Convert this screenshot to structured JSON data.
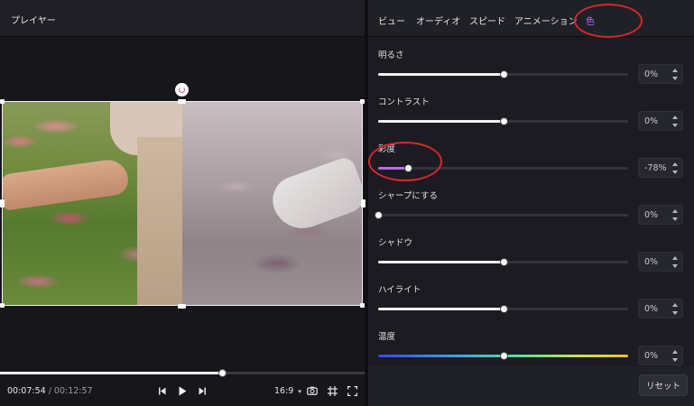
{
  "player": {
    "title": "プレイヤー",
    "current_time": "00:07:54",
    "separator": " / ",
    "duration": "00:12:57",
    "progress": 0.61,
    "aspect_ratio": "16:9"
  },
  "adjust": {
    "tabs": [
      {
        "label": "ビュー",
        "active": false
      },
      {
        "label": "オーディオ",
        "active": false
      },
      {
        "label": "スピード",
        "active": false
      },
      {
        "label": "アニメーション",
        "active": false
      },
      {
        "label": "色",
        "active": true
      }
    ],
    "rows": [
      {
        "label": "明るさ",
        "value": "0%",
        "position": 0.5
      },
      {
        "label": "コントラスト",
        "value": "0%",
        "position": 0.5
      },
      {
        "label": "彩度",
        "value": "-78%",
        "position": 0.12
      },
      {
        "label": "シャープにする",
        "value": "0%",
        "position": 0.0
      },
      {
        "label": "シャドウ",
        "value": "0%",
        "position": 0.5
      },
      {
        "label": "ハイライト",
        "value": "0%",
        "position": 0.5
      },
      {
        "label": "温度",
        "value": "0%",
        "position": 0.5
      }
    ],
    "reset_label": "リセット"
  },
  "colors": {
    "accent": "#b36cf0",
    "annotation": "#d8262e"
  }
}
